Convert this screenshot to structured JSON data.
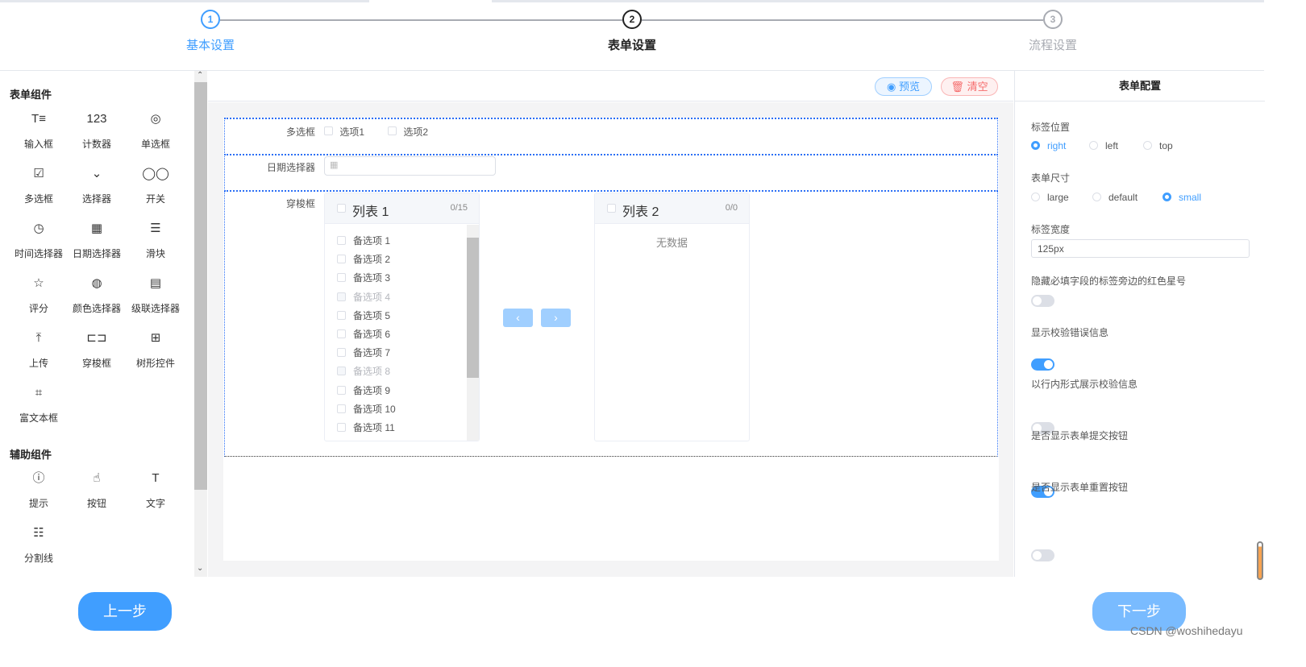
{
  "steps": [
    {
      "num": "1",
      "label": "基本设置",
      "state": "done"
    },
    {
      "num": "2",
      "label": "表单设置",
      "state": "active"
    },
    {
      "num": "3",
      "label": "流程设置",
      "state": "pending"
    }
  ],
  "left": {
    "form_section": "表单组件",
    "form_components": [
      {
        "icon": "text-input-icon",
        "glyph": "T≡",
        "label": "输入框"
      },
      {
        "icon": "counter-icon",
        "glyph": "123",
        "label": "计数器"
      },
      {
        "icon": "radio-icon",
        "glyph": "◎",
        "label": "单选框"
      },
      {
        "icon": "checkbox-icon",
        "glyph": "☑",
        "label": "多选框"
      },
      {
        "icon": "select-icon",
        "glyph": "⌄",
        "label": "选择器"
      },
      {
        "icon": "switch-icon",
        "glyph": "◯◯",
        "label": "开关"
      },
      {
        "icon": "clock-icon",
        "glyph": "◷",
        "label": "时间选择器"
      },
      {
        "icon": "calendar-icon",
        "glyph": "▦",
        "label": "日期选择器"
      },
      {
        "icon": "slider-icon",
        "glyph": "☰",
        "label": "滑块"
      },
      {
        "icon": "star-icon",
        "glyph": "☆",
        "label": "评分"
      },
      {
        "icon": "palette-icon",
        "glyph": "◍",
        "label": "颜色选择器"
      },
      {
        "icon": "cascader-icon",
        "glyph": "▤",
        "label": "级联选择器"
      },
      {
        "icon": "upload-icon",
        "glyph": "⤒",
        "label": "上传"
      },
      {
        "icon": "transfer-icon",
        "glyph": "⊏⊐",
        "label": "穿梭框"
      },
      {
        "icon": "tree-icon",
        "glyph": "⊞",
        "label": "树形控件"
      },
      {
        "icon": "rich-text-icon",
        "glyph": "⌗",
        "label": "富文本框"
      }
    ],
    "aux_section": "辅助组件",
    "aux_components": [
      {
        "icon": "info-icon",
        "glyph": "ⓘ",
        "label": "提示"
      },
      {
        "icon": "button-icon",
        "glyph": "☝",
        "label": "按钮"
      },
      {
        "icon": "text-icon",
        "glyph": "T",
        "label": "文字"
      },
      {
        "icon": "divider-icon",
        "glyph": "☷",
        "label": "分割线"
      }
    ]
  },
  "toolbar": {
    "preview": "预览",
    "clear": "清空"
  },
  "form": {
    "checkbox_label": "多选框",
    "checkbox_options": [
      "选项1",
      "选项2"
    ],
    "date_label": "日期选择器",
    "transfer_label": "穿梭框",
    "list1": {
      "title": "列表 1",
      "count": "0/15",
      "items": [
        {
          "label": "备选项 1",
          "disabled": false
        },
        {
          "label": "备选项 2",
          "disabled": false
        },
        {
          "label": "备选项 3",
          "disabled": false
        },
        {
          "label": "备选项 4",
          "disabled": true
        },
        {
          "label": "备选项 5",
          "disabled": false
        },
        {
          "label": "备选项 6",
          "disabled": false
        },
        {
          "label": "备选项 7",
          "disabled": false
        },
        {
          "label": "备选项 8",
          "disabled": true
        },
        {
          "label": "备选项 9",
          "disabled": false
        },
        {
          "label": "备选项 10",
          "disabled": false
        },
        {
          "label": "备选项 11",
          "disabled": false
        }
      ]
    },
    "list2": {
      "title": "列表 2",
      "count": "0/0",
      "empty": "无数据"
    }
  },
  "config": {
    "title": "表单配置",
    "label_position": {
      "label": "标签位置",
      "options": [
        "right",
        "left",
        "top"
      ],
      "selected": "right"
    },
    "size": {
      "label": "表单尺寸",
      "options": [
        "large",
        "default",
        "small"
      ],
      "selected": "small"
    },
    "label_width": {
      "label": "标签宽度",
      "value": "125px"
    },
    "toggles": [
      {
        "label": "隐藏必填字段的标签旁边的红色星号",
        "on": false
      },
      {
        "label": "显示校验错误信息",
        "on": true
      },
      {
        "label": "以行内形式展示校验信息",
        "on": false
      },
      {
        "label": "是否显示表单提交按钮",
        "on": true
      },
      {
        "label": "是否显示表单重置按钮",
        "on": false
      }
    ]
  },
  "footer": {
    "prev": "上一步",
    "next": "下一步",
    "watermark": "CSDN @woshihedayu"
  },
  "colors": {
    "primary": "#409eff",
    "danger": "#f56c6c",
    "disabled_btn": "#79bbff"
  }
}
